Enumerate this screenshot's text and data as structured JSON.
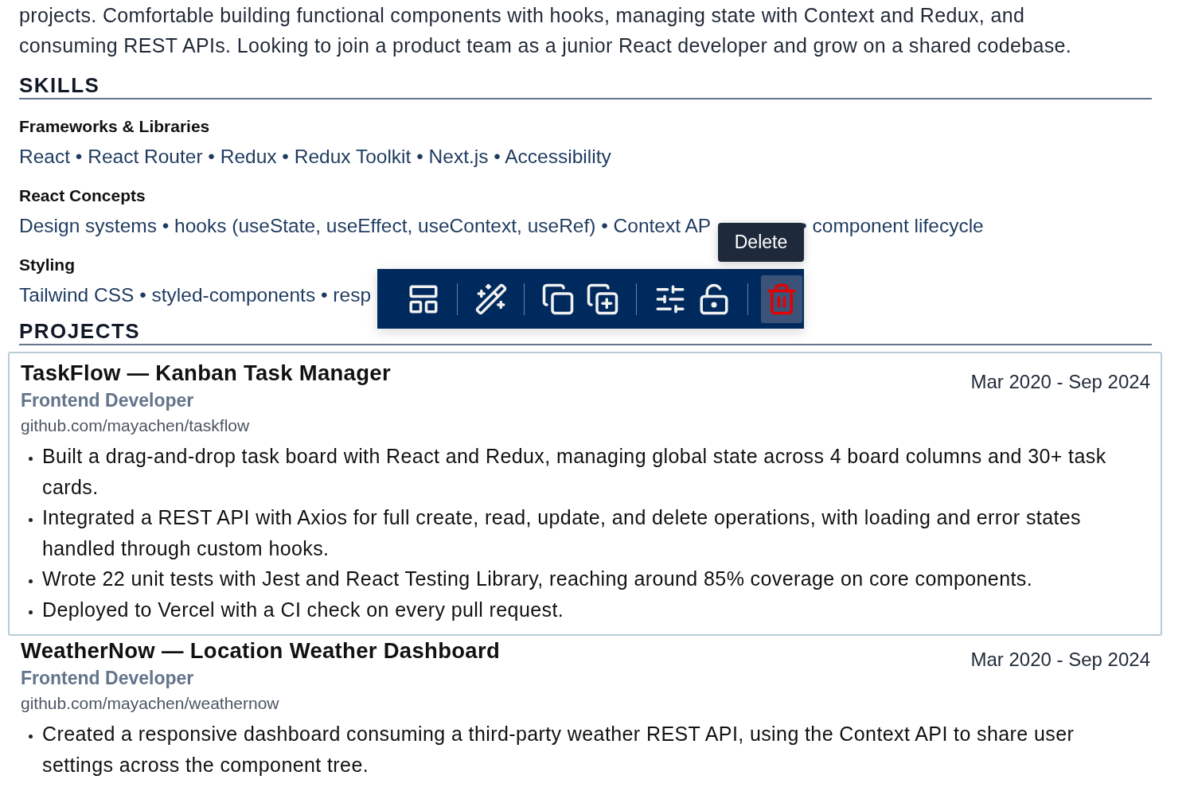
{
  "summary": {
    "lines": [
      "projects. Comfortable building functional components with hooks, managing state with Context and Redux, and",
      "consuming REST APIs. Looking to join a product team as a junior React developer and grow on a shared codebase."
    ]
  },
  "skills": {
    "heading": "SKILLS",
    "groups": [
      {
        "title": "Frameworks & Libraries",
        "text": "React • React Router • Redux • Redux Toolkit • Next.js • Accessibility"
      },
      {
        "title": "React Concepts",
        "text": "Design systems • hooks (useState, useEffect, useContext, useRef) • Context AP",
        "text_after": "• component lifecycle"
      },
      {
        "title": "Styling",
        "text": "Tailwind CSS • styled-components • resp"
      }
    ]
  },
  "projects": {
    "heading": "PROJECTS",
    "items": [
      {
        "title": "TaskFlow — Kanban Task Manager",
        "role": "Frontend Developer",
        "link": "github.com/mayachen/taskflow",
        "dates": "Mar 2020 - Sep 2024",
        "selected": true,
        "bullets": [
          "Built a drag-and-drop task board with React and Redux, managing global state across 4 board columns and 30+ task cards.",
          "Integrated a REST API with Axios for full create, read, update, and delete operations, with loading and error states handled through custom hooks.",
          "Wrote 22 unit tests with Jest and React Testing Library, reaching around 85% coverage on core components.",
          "Deployed to Vercel with a CI check on every pull request."
        ]
      },
      {
        "title": "WeatherNow — Location Weather Dashboard",
        "role": "Frontend Developer",
        "link": "github.com/mayachen/weathernow",
        "dates": "Mar 2020 - Sep 2024",
        "selected": false,
        "bullets": [
          "Created a responsive dashboard consuming a third-party weather REST API, using the Context API to share user settings across the component tree."
        ]
      }
    ]
  },
  "toolbar": {
    "groups": [
      [
        {
          "kind": "layout",
          "highlighted": false
        }
      ],
      [
        {
          "kind": "magic",
          "highlighted": false
        }
      ],
      [
        {
          "kind": "copy",
          "highlighted": false
        },
        {
          "kind": "duplicate",
          "highlighted": false
        }
      ],
      [
        {
          "kind": "settings",
          "highlighted": false
        },
        {
          "kind": "unlock",
          "highlighted": false
        }
      ],
      [
        {
          "kind": "delete",
          "highlighted": true
        }
      ]
    ],
    "tooltip": "Delete"
  }
}
